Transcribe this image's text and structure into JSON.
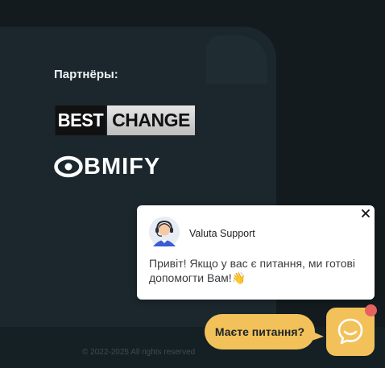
{
  "partners": {
    "title": "Партнёры:",
    "bestchange": {
      "part1": "BEST",
      "part2": "CHANGE"
    },
    "obmify": {
      "text": "BMIFY"
    }
  },
  "footer": {
    "copyright": "© 2022-2025 All rights reserved"
  },
  "chat_popup": {
    "agent_name": "Valuta Support",
    "message": "Привіт! Якщо у вас є питання, ми готові допомогти Вам!👋"
  },
  "chat_widget": {
    "prompt": "Маєте питання?"
  },
  "colors": {
    "accent": "#f2c15a",
    "notification": "#e76161",
    "card": "#1b272c"
  }
}
